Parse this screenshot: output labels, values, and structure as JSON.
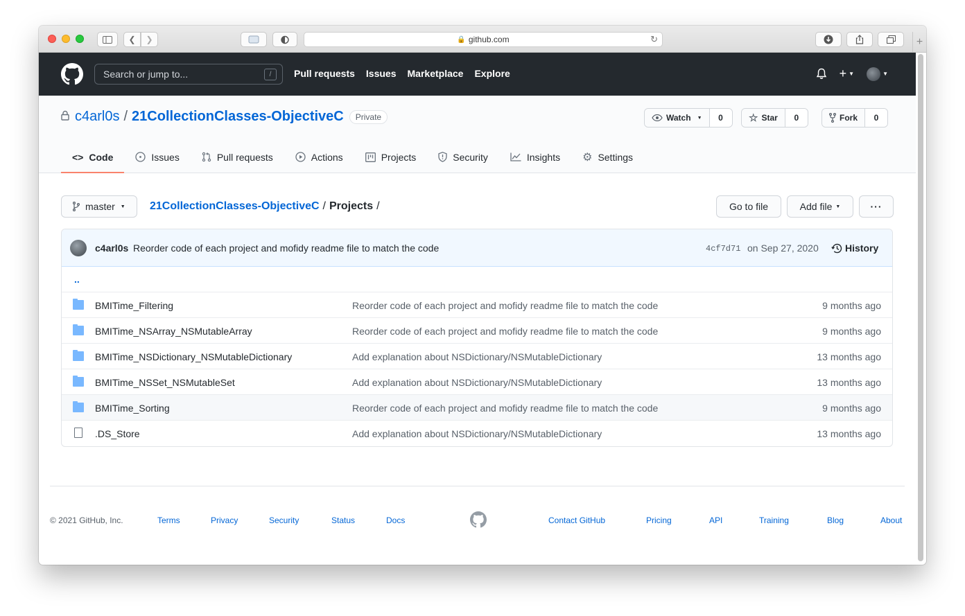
{
  "browser": {
    "url": "github.com"
  },
  "header": {
    "search_placeholder": "Search or jump to...",
    "search_shortcut": "/",
    "nav": [
      "Pull requests",
      "Issues",
      "Marketplace",
      "Explore"
    ],
    "plus": "+"
  },
  "repo": {
    "owner": "c4arl0s",
    "name": "21CollectionClasses-ObjectiveC",
    "visibility": "Private",
    "watch": {
      "label": "Watch",
      "count": "0"
    },
    "star": {
      "label": "Star",
      "count": "0"
    },
    "fork": {
      "label": "Fork",
      "count": "0"
    },
    "tabs": [
      {
        "label": "Code",
        "icon": "code-icon"
      },
      {
        "label": "Issues",
        "icon": "issue-icon"
      },
      {
        "label": "Pull requests",
        "icon": "pull-request-icon"
      },
      {
        "label": "Actions",
        "icon": "play-icon"
      },
      {
        "label": "Projects",
        "icon": "project-icon"
      },
      {
        "label": "Security",
        "icon": "shield-icon"
      },
      {
        "label": "Insights",
        "icon": "graph-icon"
      },
      {
        "label": "Settings",
        "icon": "gear-icon"
      }
    ]
  },
  "browse": {
    "branch": "master",
    "crumb_repo": "21CollectionClasses-ObjectiveC",
    "crumb_sep": "/",
    "crumb_dir": "Projects",
    "crumb_trail": "/",
    "goto_file": "Go to file",
    "add_file": "Add file",
    "more": "···"
  },
  "commit": {
    "author": "c4arl0s",
    "message": "Reorder code of each project and mofidy readme file to match the code",
    "sha": "4cf7d71",
    "date": "on Sep 27, 2020",
    "history": "History"
  },
  "files": {
    "up": "..",
    "rows": [
      {
        "name": "BMITime_Filtering",
        "message": "Reorder code of each project and mofidy readme file to match the code",
        "age": "9 months ago",
        "type": "folder"
      },
      {
        "name": "BMITime_NSArray_NSMutableArray",
        "message": "Reorder code of each project and mofidy readme file to match the code",
        "age": "9 months ago",
        "type": "folder"
      },
      {
        "name": "BMITime_NSDictionary_NSMutableDictionary",
        "message": "Add explanation about NSDictionary/NSMutableDictionary",
        "age": "13 months ago",
        "type": "folder"
      },
      {
        "name": "BMITime_NSSet_NSMutableSet",
        "message": "Add explanation about NSDictionary/NSMutableDictionary",
        "age": "13 months ago",
        "type": "folder"
      },
      {
        "name": "BMITime_Sorting",
        "message": "Reorder code of each project and mofidy readme file to match the code",
        "age": "9 months ago",
        "type": "folder"
      },
      {
        "name": ".DS_Store",
        "message": "Add explanation about NSDictionary/NSMutableDictionary",
        "age": "13 months ago",
        "type": "file"
      }
    ]
  },
  "footer": {
    "copyright": "© 2021 GitHub, Inc.",
    "left_links": [
      "Terms",
      "Privacy",
      "Security",
      "Status",
      "Docs"
    ],
    "right_links": [
      "Contact GitHub",
      "Pricing",
      "API",
      "Training",
      "Blog",
      "About"
    ]
  },
  "colors": {
    "header_bg": "#24292e",
    "link": "#0366d6",
    "active_tab": "#f9826c",
    "folder": "#79b8ff"
  }
}
